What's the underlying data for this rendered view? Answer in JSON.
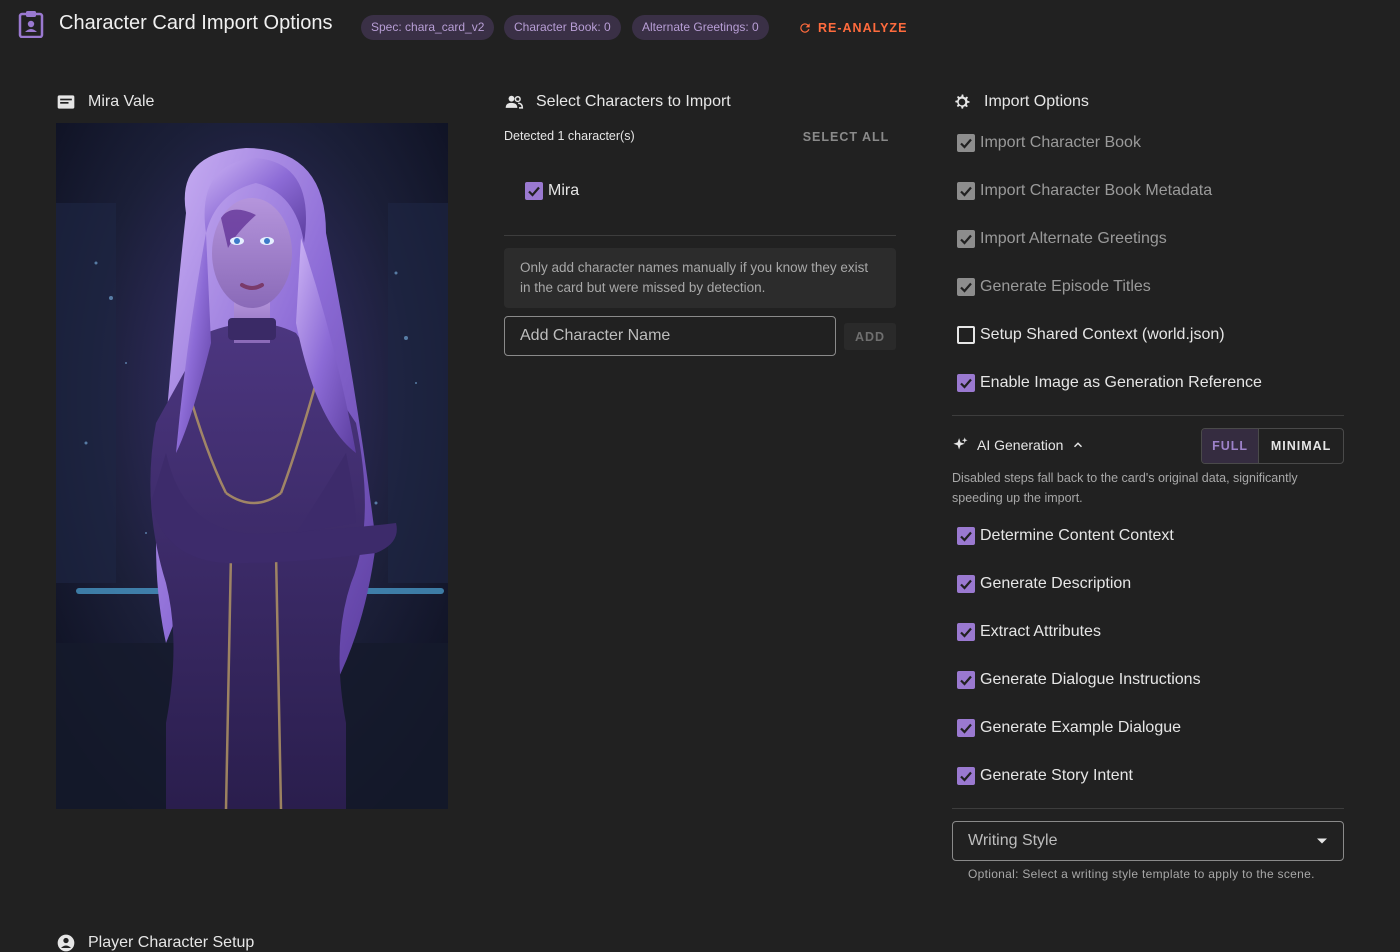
{
  "header": {
    "title": "Character Card Import Options",
    "chips": [
      {
        "label": "Spec: chara_card_v2"
      },
      {
        "label": "Character Book: 0"
      },
      {
        "label": "Alternate Greetings: 0"
      }
    ],
    "reanalyze_label": "RE-ANALYZE"
  },
  "character_panel": {
    "name": "Mira Vale",
    "icon": "id-card-icon"
  },
  "select_panel": {
    "title": "Select Characters to Import",
    "detected_text": "Detected 1 character(s)",
    "select_all_label": "SELECT ALL",
    "characters": [
      {
        "name": "Mira",
        "checked": true
      }
    ],
    "manual_note": "Only add character names manually if you know they exist in the card but were missed by detection.",
    "add_name_placeholder": "Add Character Name",
    "add_label": "ADD"
  },
  "import_options": {
    "title": "Import Options",
    "options": [
      {
        "label": "Import Character Book",
        "checked": true,
        "disabled": true
      },
      {
        "label": "Import Character Book Metadata",
        "checked": true,
        "disabled": true
      },
      {
        "label": "Import Alternate Greetings",
        "checked": true,
        "disabled": true
      },
      {
        "label": "Generate Episode Titles",
        "checked": true,
        "disabled": true
      },
      {
        "label": "Setup Shared Context (world.json)",
        "checked": false,
        "disabled": false
      },
      {
        "label": "Enable Image as Generation Reference",
        "checked": true,
        "disabled": false
      }
    ],
    "ai_generation": {
      "title": "AI Generation",
      "mode_full": "FULL",
      "mode_minimal": "MINIMAL",
      "selected_mode": "FULL",
      "description": "Disabled steps fall back to the card's original data, significantly speeding up the import.",
      "steps": [
        {
          "label": "Determine Content Context",
          "checked": true
        },
        {
          "label": "Generate Description",
          "checked": true
        },
        {
          "label": "Extract Attributes",
          "checked": true
        },
        {
          "label": "Generate Dialogue Instructions",
          "checked": true
        },
        {
          "label": "Generate Example Dialogue",
          "checked": true
        },
        {
          "label": "Generate Story Intent",
          "checked": true
        }
      ]
    },
    "writing_style": {
      "label": "Writing Style",
      "helper": "Optional: Select a writing style template to apply to the scene."
    }
  },
  "player_section": {
    "title": "Player Character Setup"
  },
  "colors": {
    "accent": "#9a79d0",
    "warning": "#ff6b3d",
    "background": "#212121"
  }
}
